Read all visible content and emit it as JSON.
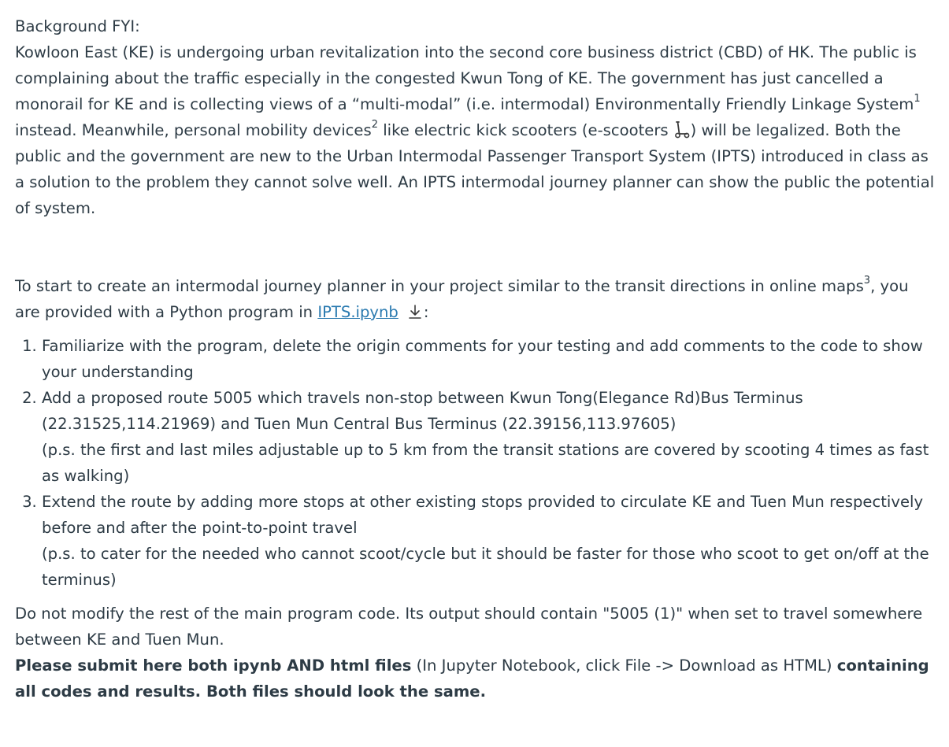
{
  "background": {
    "heading": "Background FYI:",
    "p1": "Kowloon East (KE) is undergoing urban revitalization into the second core business district (CBD) of HK. The public is complaining about the traffic especially in the congested Kwun Tong of KE. The government has just cancelled a monorail for KE and is collecting views of a “multi-modal” (i.e. intermodal) Environmentally Friendly Linkage System",
    "sup1": "1",
    "p2": " instead. Meanwhile, personal mobility devices",
    "sup2": "2",
    "p3": " like electric kick scooters (e-scooters",
    "p4": ") will be legalized. Both the public and the government are new to the Urban Intermodal Passenger Transport System (IPTS) introduced in class as a solution to the problem they cannot solve well. An IPTS intermodal journey planner can show the public the potential of system.",
    "scooter_icon": "scooter-icon"
  },
  "start": {
    "text1": "To start to create an intermodal journey planner in your project similar to the transit directions in online maps",
    "sup3": "3",
    "text2": ", you are provided with a Python program in ",
    "link_text": "IPTS.ipynb",
    "link_color": "#2a7ab0",
    "download_icon": "download-icon",
    "colon": ":"
  },
  "steps": [
    {
      "main": "Familiarize with the program, delete the origin comments for your testing and add comments to the code to show your understanding"
    },
    {
      "main": "Add a proposed route 5005 which travels non-stop between Kwun Tong(Elegance Rd)Bus Terminus (22.31525,114.21969) and Tuen Mun Central Bus Terminus (22.39156,113.97605)",
      "note": "(p.s. the first and last miles adjustable up to 5 km from the transit stations are covered by scooting 4 times as fast as walking)"
    },
    {
      "main": "Extend the route by adding more stops at other existing stops provided to circulate KE and Tuen Mun respectively before and after the point-to-point travel",
      "note": "(p.s. to cater for the needed who cannot scoot/cycle but it should be faster for those who scoot to get on/off at the terminus)"
    }
  ],
  "closing": {
    "text": "Do not modify the rest of the main program code. Its output should contain \"5005 (1)\" when set to travel somewhere between KE and Tuen Mun.",
    "bold1": "Please submit here both ipynb AND html files",
    "normal": " (In Jupyter Notebook, click File -> Download as HTML) ",
    "bold2": "containing all codes and results. Both files should look the same."
  }
}
